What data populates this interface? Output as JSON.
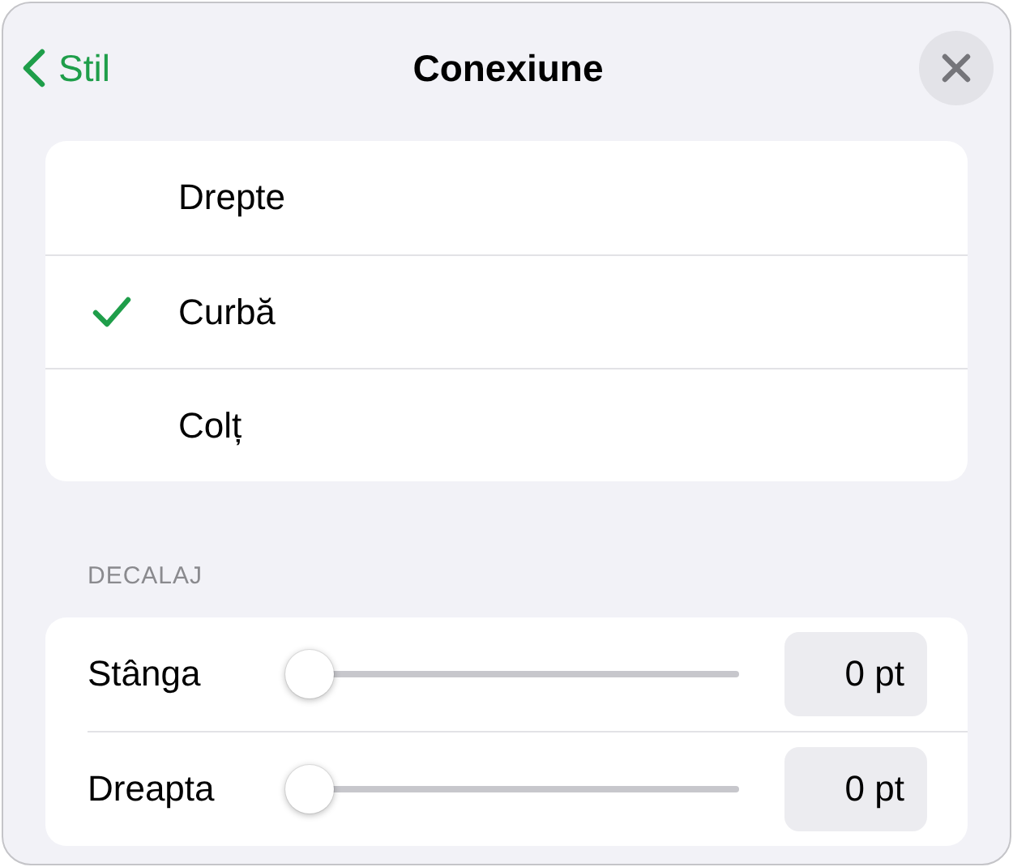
{
  "header": {
    "back_label": "Stil",
    "title": "Conexiune"
  },
  "options": [
    {
      "label": "Drepte",
      "selected": false
    },
    {
      "label": "Curbă",
      "selected": true
    },
    {
      "label": "Colț",
      "selected": false
    }
  ],
  "offset": {
    "heading": "DECALAJ",
    "sliders": [
      {
        "label": "Stânga",
        "level": 0,
        "value": "0 pt"
      },
      {
        "label": "Dreapta",
        "level": 0,
        "value": "0 pt"
      }
    ]
  }
}
